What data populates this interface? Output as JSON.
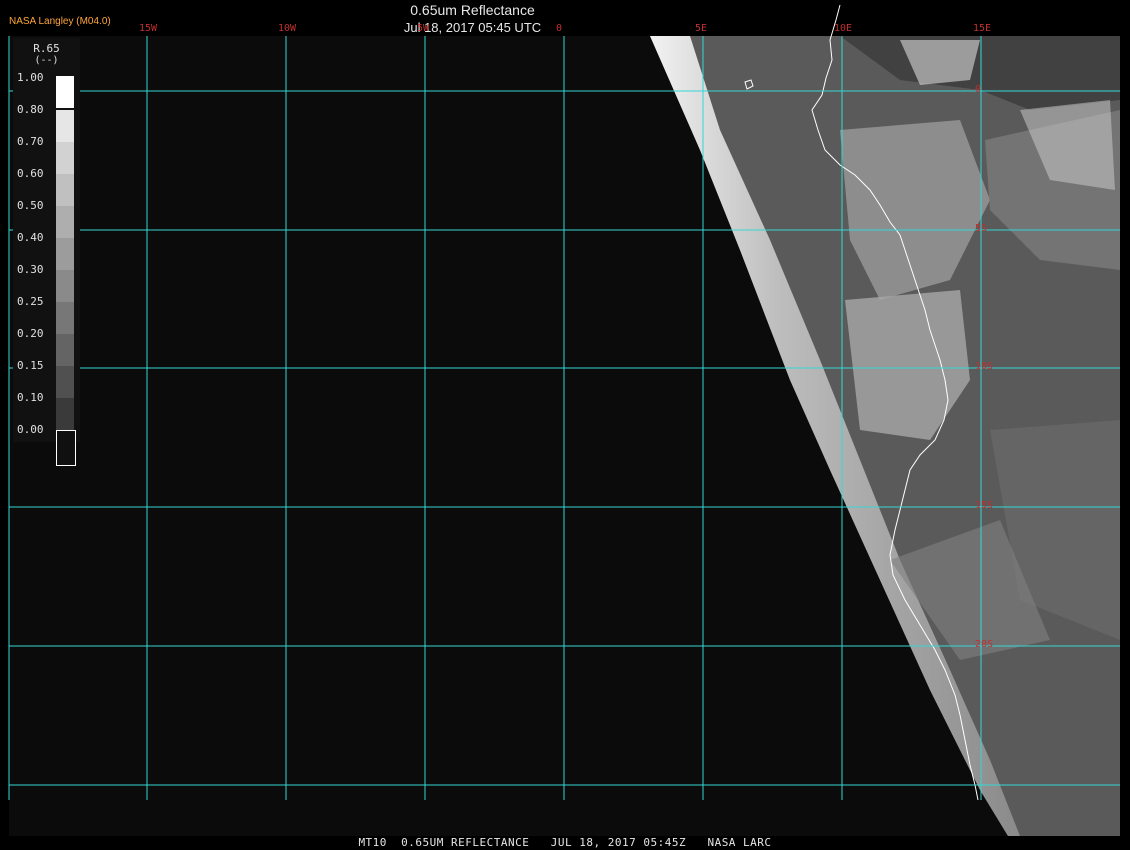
{
  "header": {
    "agency": "NASA Langley (M04.0)",
    "title": "0.65um Reflectance",
    "datetime": "Jul 18, 2017 05:45 UTC"
  },
  "footer": {
    "caption": "MT10  0.65UM REFLECTANCE   JUL 18, 2017 05:45Z   NASA LARC"
  },
  "legend": {
    "name": "R.65",
    "unit": "(--)",
    "ticks": [
      "1.00",
      "0.80",
      "0.70",
      "0.60",
      "0.50",
      "0.40",
      "0.30",
      "0.25",
      "0.20",
      "0.15",
      "0.10",
      "0.00"
    ],
    "shades": [
      "#ffffff",
      "#e6e6e6",
      "#d2d2d2",
      "#c0c0c0",
      "#aeaeae",
      "#9c9c9c",
      "#8a8a8a",
      "#777777",
      "#646464",
      "#505050",
      "#3a3a3a",
      "#101010"
    ]
  },
  "grid": {
    "lon_labels": [
      "15W",
      "10W",
      "5W",
      "0",
      "5E",
      "10E",
      "15E"
    ],
    "lat_labels": [
      "0",
      "5S",
      "10S",
      "15S",
      "20S"
    ],
    "line_color": "#35d6d6",
    "label_color": "#c03030"
  },
  "colors": {
    "background": "#000000",
    "ocean": "#0b0b0b",
    "coastline": "#ffffff"
  }
}
